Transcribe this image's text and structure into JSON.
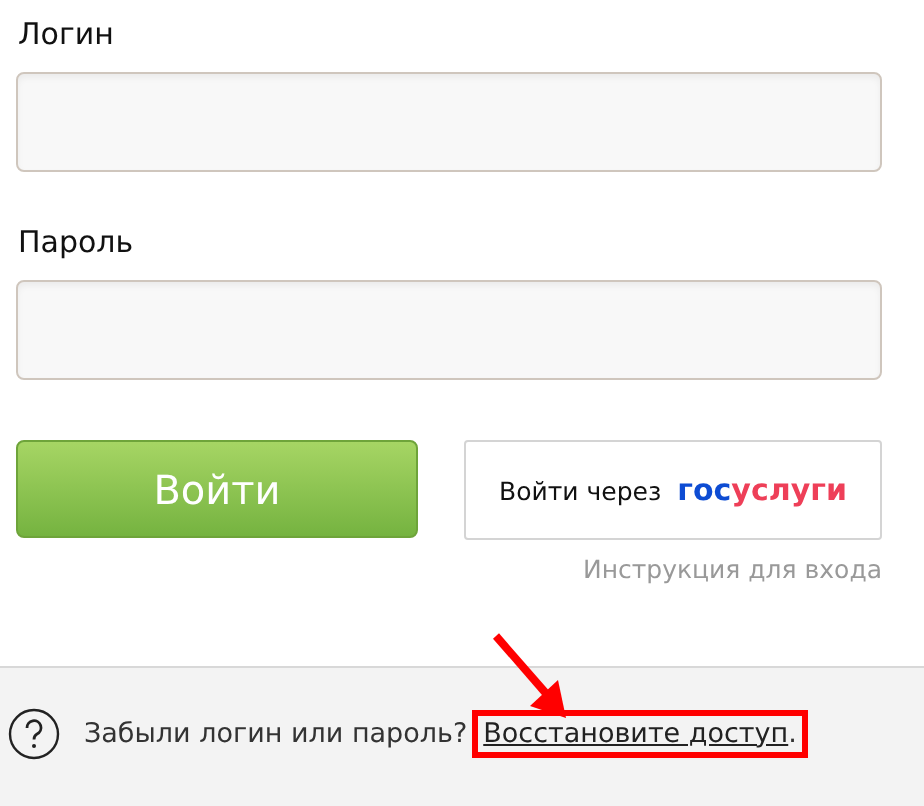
{
  "login": {
    "label": "Логин"
  },
  "password": {
    "label": "Пароль"
  },
  "submit_button": "Войти",
  "gosuslugi_button": {
    "label": "Войти через",
    "logo": [
      "гос",
      "услуги"
    ]
  },
  "instruction_link": "Инструкция для входа",
  "footer": {
    "question": "Забыли логин или пароль?",
    "link": "Восстановите доступ",
    "end": ".",
    "highlighted": true
  }
}
